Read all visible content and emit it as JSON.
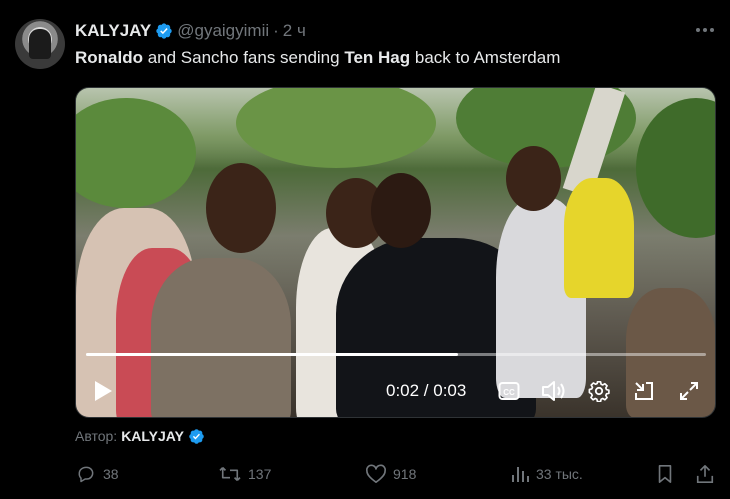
{
  "tweet": {
    "author_name": "KALYJAY",
    "handle": "@gyaigyimii",
    "separator": "·",
    "time": "2 ч",
    "text": {
      "part1": "Ronaldo",
      "part2": " and Sancho fans sending ",
      "part3": "Ten Hag",
      "part4": " back to Amsterdam"
    }
  },
  "video": {
    "timecode": "0:02 / 0:03",
    "progress_fraction": 0.6
  },
  "attribution": {
    "prefix": "Автор:",
    "name": "KALYJAY"
  },
  "actions": {
    "replies": "38",
    "retweets": "137",
    "likes": "918",
    "views": "33 тыс."
  },
  "colors": {
    "background": "#000000",
    "text_primary": "#e7e9ea",
    "text_secondary": "#71767b",
    "verified": "#1d9bf0"
  },
  "icons": {
    "verified": "verified-badge-icon",
    "more": "more-icon",
    "play": "play-icon",
    "captions": "captions-icon",
    "volume": "volume-icon",
    "settings": "gear-icon",
    "pip": "picture-in-picture-icon",
    "fullscreen": "fullscreen-icon",
    "reply": "reply-icon",
    "retweet": "retweet-icon",
    "like": "heart-icon",
    "views": "views-icon",
    "bookmark": "bookmark-icon",
    "share": "share-icon"
  }
}
